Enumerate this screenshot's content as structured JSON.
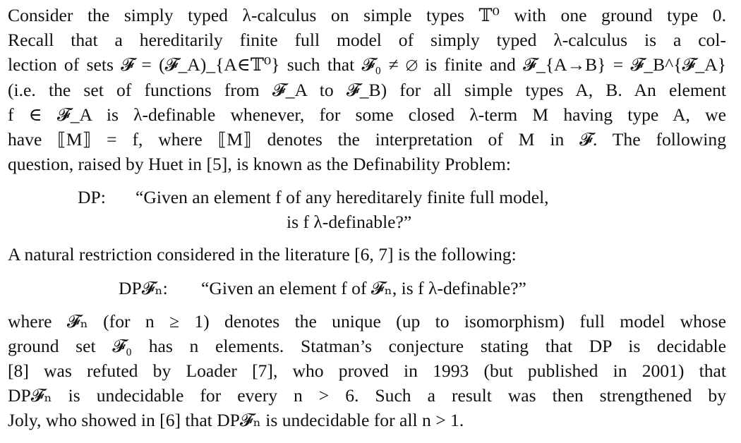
{
  "paragraph1": {
    "lines": [
      "Consider the simply typed λ-calculus on simple types 𝕋⁰ with one ground type 0.",
      "Recall that a hereditarily finite full model of simply typed λ-calculus is a col-",
      "lection of sets 𝓕 = (𝓕_A)_{A∈𝕋⁰} such that 𝓕₀ ≠ ∅ is finite and 𝓕_{A→B} = 𝓕_B^{𝓕_A}",
      "(i.e. the set of functions from 𝓕_A to 𝓕_B) for all simple types A, B. An element",
      "f ∈ 𝓕_A is λ-definable whenever, for some closed λ-term M having type A, we",
      "have ⟦M⟧ = f, where ⟦M⟧ denotes the interpretation of M in 𝓕. The following",
      "question, raised by Huet in [5], is known as the Definability Problem:"
    ]
  },
  "dp": {
    "label": "DP:",
    "line1": "“Given an element f of any hereditarely finite full model,",
    "line2": "is f λ-definable?”"
  },
  "paragraph2": {
    "text": "A natural restriction considered in the literature [6, 7] is the following:"
  },
  "dpfn": {
    "label": "DP𝓕ₙ:",
    "text": "“Given an element f of 𝓕ₙ, is f λ-definable?”"
  },
  "paragraph3": {
    "lines": [
      "where 𝓕ₙ (for n ≥ 1) denotes the unique (up to isomorphism) full model whose",
      "ground set 𝓕₀ has n elements. Statman’s conjecture stating that DP is decidable",
      "[8] was refuted by Loader [7], who proved in 1993 (but published in 2001) that",
      "DP𝓕ₙ is undecidable for every n > 6. Such a result was then strengthened by",
      "Joly, who showed in [6] that DP𝓕ₙ is undecidable for all n > 1."
    ]
  }
}
